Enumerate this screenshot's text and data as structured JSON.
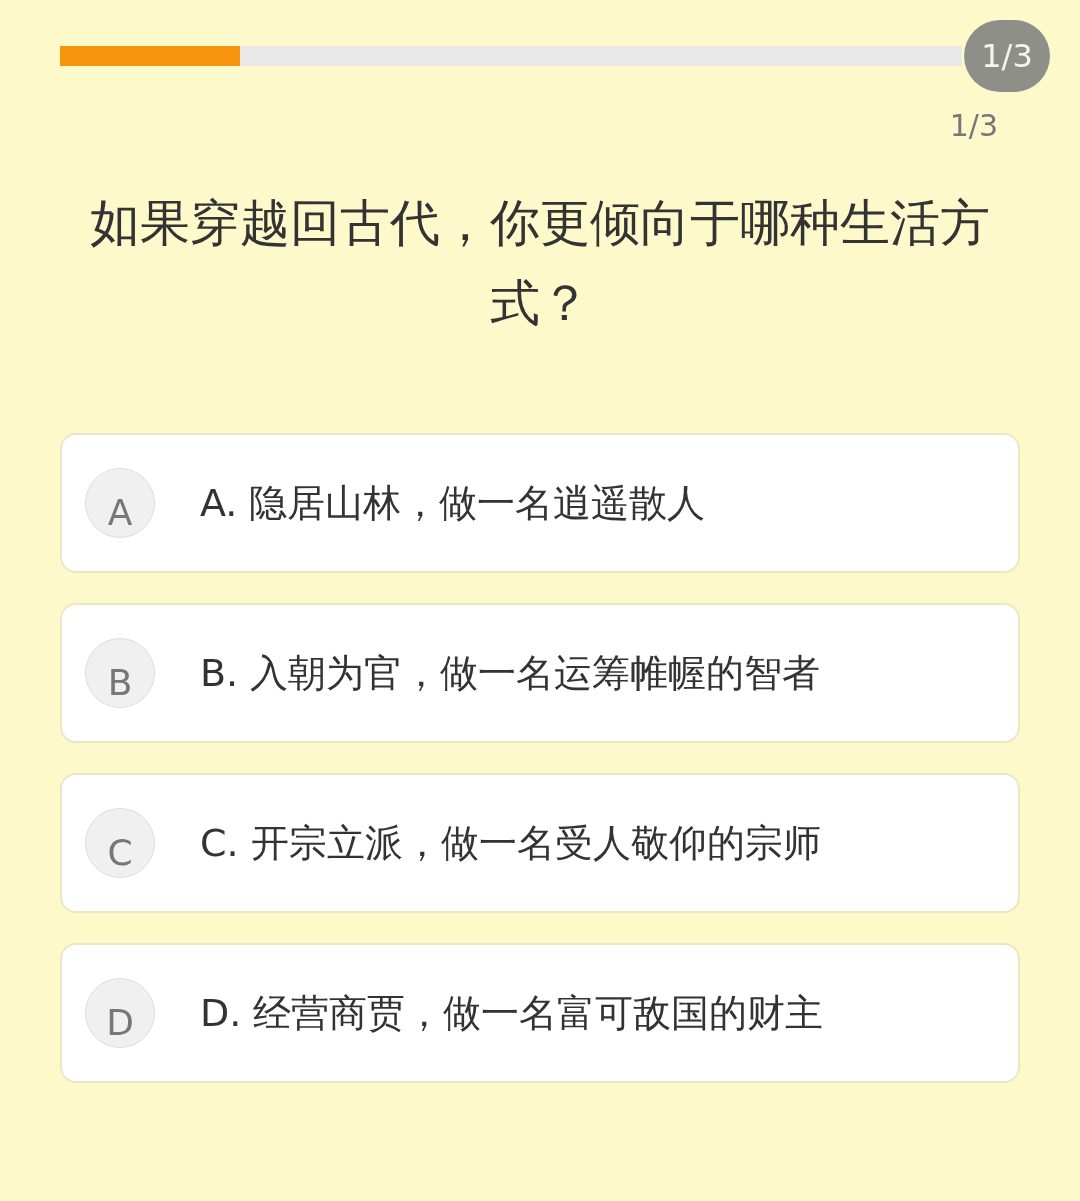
{
  "progress": {
    "level": 0.2,
    "badge": "1/3"
  },
  "counter": "1/3",
  "question": "如果穿越回古代，你更倾向于哪种生活方式？",
  "options": [
    {
      "letter": "A",
      "text": "A. 隐居山林，做一名逍遥散人",
      "selected": false
    },
    {
      "letter": "B",
      "text": "B. 入朝为官，做一名运筹帷幄的智者",
      "selected": false
    },
    {
      "letter": "C",
      "text": "C. 开宗立派，做一名受人敬仰的宗师",
      "selected": false
    },
    {
      "letter": "D",
      "text": "D. 经营商贾，做一名富可敌国的财主",
      "selected": false
    }
  ]
}
